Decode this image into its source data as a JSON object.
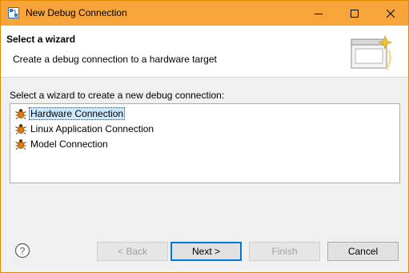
{
  "window": {
    "title": "New Debug Connection",
    "accent_color": "#f7a53a"
  },
  "header": {
    "title": "Select a wizard",
    "description": "Create a debug connection to a hardware target"
  },
  "main": {
    "prompt": "Select a wizard to create a new debug connection:",
    "items": [
      {
        "label": "Hardware Connection",
        "icon": "bug-connection-icon",
        "selected": true
      },
      {
        "label": "Linux Application Connection",
        "icon": "bug-connection-icon",
        "selected": false
      },
      {
        "label": "Model Connection",
        "icon": "bug-connection-icon",
        "selected": false
      }
    ]
  },
  "footer": {
    "back_label": "< Back",
    "next_label": "Next >",
    "finish_label": "Finish",
    "cancel_label": "Cancel"
  }
}
